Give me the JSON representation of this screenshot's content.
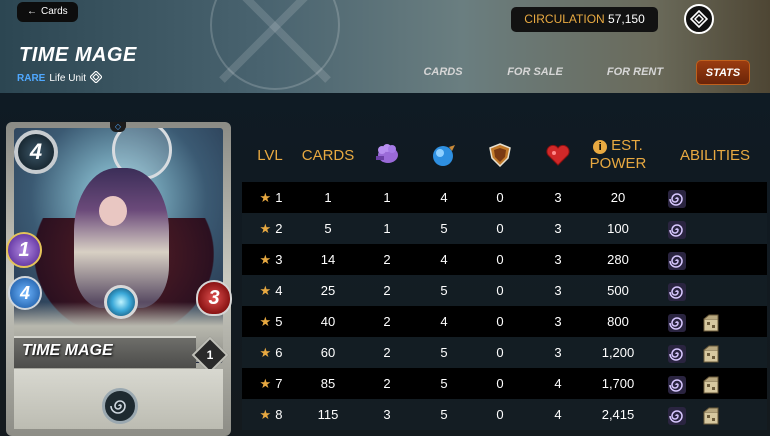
{
  "nav": {
    "back_label": "Cards"
  },
  "header": {
    "title": "TIME MAGE",
    "rarity": "RARE",
    "unit_type": "Life Unit",
    "circulation_label": "CIRCULATION",
    "circulation_value": "57,150"
  },
  "tabs": [
    {
      "label": "CARDS",
      "active": false
    },
    {
      "label": "FOR SALE",
      "active": false
    },
    {
      "label": "FOR RENT",
      "active": false
    },
    {
      "label": "STATS",
      "active": true
    }
  ],
  "card": {
    "name": "TIME MAGE",
    "mana": "4",
    "melee": "1",
    "speed": "4",
    "health": "3",
    "level": "1",
    "ability_icon": "spiral-ability-icon"
  },
  "table": {
    "headers": {
      "lvl": "LVL",
      "cards": "CARDS",
      "melee_icon": "melee-fist-icon",
      "speed_icon": "speed-icon",
      "armor_icon": "armor-shield-icon",
      "health_icon": "health-heart-icon",
      "power_info_icon": "info-icon",
      "power_line1": "EST.",
      "power_line2": "POWER",
      "abilities": "ABILITIES"
    },
    "rows": [
      {
        "lvl": "1",
        "cards": "1",
        "melee": "1",
        "speed": "4",
        "armor": "0",
        "health": "3",
        "power": "20",
        "abilities": [
          "spiral-ability-icon"
        ]
      },
      {
        "lvl": "2",
        "cards": "5",
        "melee": "1",
        "speed": "5",
        "armor": "0",
        "health": "3",
        "power": "100",
        "abilities": [
          "spiral-ability-icon"
        ]
      },
      {
        "lvl": "3",
        "cards": "14",
        "melee": "2",
        "speed": "4",
        "armor": "0",
        "health": "3",
        "power": "280",
        "abilities": [
          "spiral-ability-icon"
        ]
      },
      {
        "lvl": "4",
        "cards": "25",
        "melee": "2",
        "speed": "5",
        "armor": "0",
        "health": "3",
        "power": "500",
        "abilities": [
          "spiral-ability-icon"
        ]
      },
      {
        "lvl": "5",
        "cards": "40",
        "melee": "2",
        "speed": "4",
        "armor": "0",
        "health": "3",
        "power": "800",
        "abilities": [
          "spiral-ability-icon",
          "crate-ability-icon"
        ]
      },
      {
        "lvl": "6",
        "cards": "60",
        "melee": "2",
        "speed": "5",
        "armor": "0",
        "health": "3",
        "power": "1,200",
        "abilities": [
          "spiral-ability-icon",
          "crate-ability-icon"
        ]
      },
      {
        "lvl": "7",
        "cards": "85",
        "melee": "2",
        "speed": "5",
        "armor": "0",
        "health": "4",
        "power": "1,700",
        "abilities": [
          "spiral-ability-icon",
          "crate-ability-icon"
        ]
      },
      {
        "lvl": "8",
        "cards": "115",
        "melee": "3",
        "speed": "5",
        "armor": "0",
        "health": "4",
        "power": "2,415",
        "abilities": [
          "spiral-ability-icon",
          "crate-ability-icon"
        ]
      }
    ]
  },
  "colors": {
    "accent": "#e8a941",
    "rarity": "#4fa8ff",
    "active_tab": "#8a3410",
    "row_dark": "#000000",
    "row_light": "#141e24"
  }
}
